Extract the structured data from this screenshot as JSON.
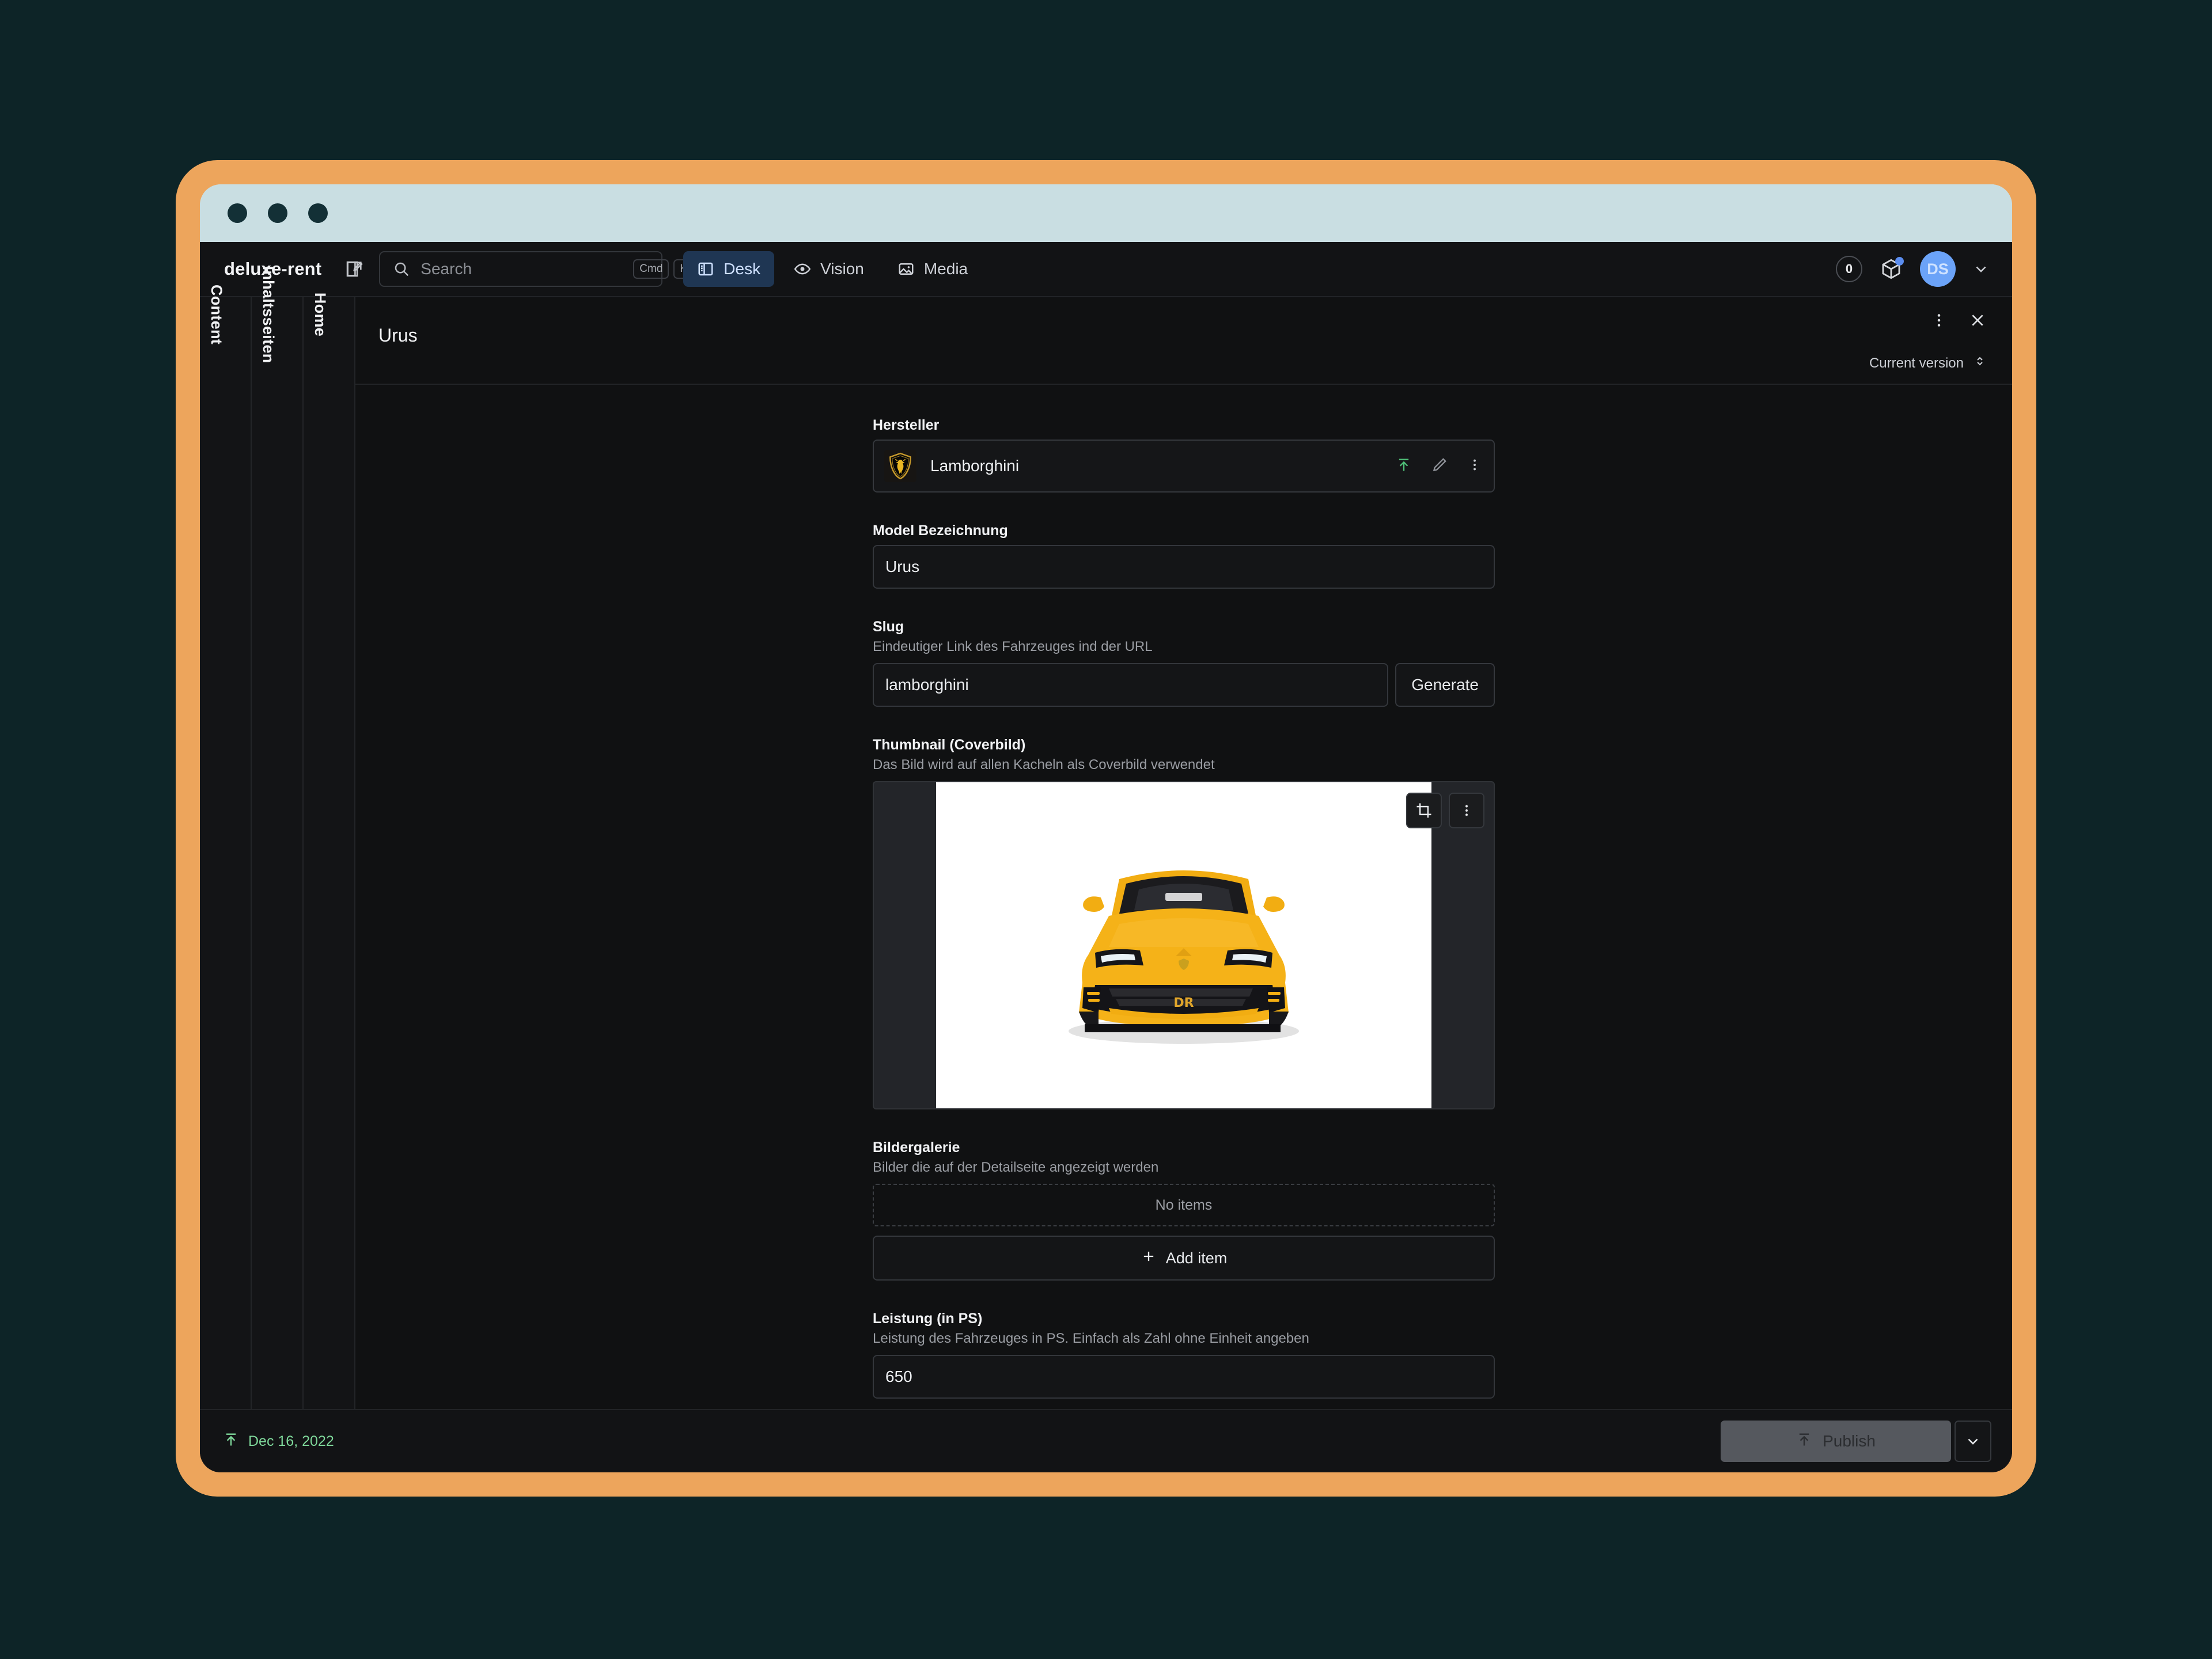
{
  "window": {
    "traffic_lights": [
      "close",
      "minimize",
      "zoom"
    ]
  },
  "navbar": {
    "brand": "deluxe-rent",
    "compose_icon": "compose-icon",
    "search": {
      "placeholder": "Search",
      "value": "",
      "icon": "search-icon",
      "shortcut_mod": "Cmd",
      "shortcut_key": "K"
    },
    "tabs": [
      {
        "label": "Desk",
        "icon": "desk-icon",
        "active": true
      },
      {
        "label": "Vision",
        "icon": "eye-icon",
        "active": false
      },
      {
        "label": "Media",
        "icon": "image-icon",
        "active": false
      }
    ],
    "right": {
      "badge_count": "0",
      "package_icon": "package-icon",
      "avatar_initials": "DS",
      "caret_icon": "chevron-down-icon"
    }
  },
  "panes": [
    {
      "label": "Content"
    },
    {
      "label": "Inhaltsseiten"
    },
    {
      "label": "Home"
    }
  ],
  "document": {
    "title": "Urus",
    "menu_icon": "kebab-menu-icon",
    "close_icon": "close-icon",
    "version_label": "Current version",
    "version_caret_icon": "chevron-updown-icon"
  },
  "fields": {
    "hersteller": {
      "label": "Hersteller",
      "value": "Lamborghini",
      "logo_icon": "lamborghini-shield-icon",
      "publish_icon": "publish-arrow-icon",
      "edit_icon": "pencil-icon",
      "menu_icon": "kebab-menu-icon"
    },
    "model": {
      "label": "Model Bezeichnung",
      "value": "Urus"
    },
    "slug": {
      "label": "Slug",
      "description": "Eindeutiger Link des Fahrzeuges ind der URL",
      "value": "lamborghini",
      "generate_label": "Generate"
    },
    "thumbnail": {
      "label": "Thumbnail (Coverbild)",
      "description": "Das Bild wird auf allen Kacheln als Coverbild verwendet",
      "crop_icon": "crop-icon",
      "menu_icon": "kebab-menu-icon",
      "image_alt": "yellow-lamborghini-urus-front-view"
    },
    "gallery": {
      "label": "Bildergalerie",
      "description": "Bilder die auf der Detailseite angezeigt werden",
      "empty_label": "No items",
      "add_label": "Add item",
      "add_icon": "plus-icon"
    },
    "leistung": {
      "label": "Leistung (in PS)",
      "description": "Leistung des Fahrzeuges in PS. Einfach als Zahl ohne Einheit angeben",
      "value": "650"
    }
  },
  "footer": {
    "status_icon": "publish-arrow-icon",
    "status_date": "Dec 16, 2022",
    "publish_label": "Publish",
    "publish_icon": "publish-arrow-icon",
    "publish_caret_icon": "chevron-down-icon"
  },
  "colors": {
    "frame_orange": "#eda55c",
    "page_background": "#0d2427",
    "titlebar": "#c9dee2",
    "app_background": "#101112",
    "accent_blue": "#6ba3f8",
    "active_tab_bg": "#1f3653",
    "publish_green": "#7fd99b",
    "lamborghini_yellow": "#f5b218"
  }
}
